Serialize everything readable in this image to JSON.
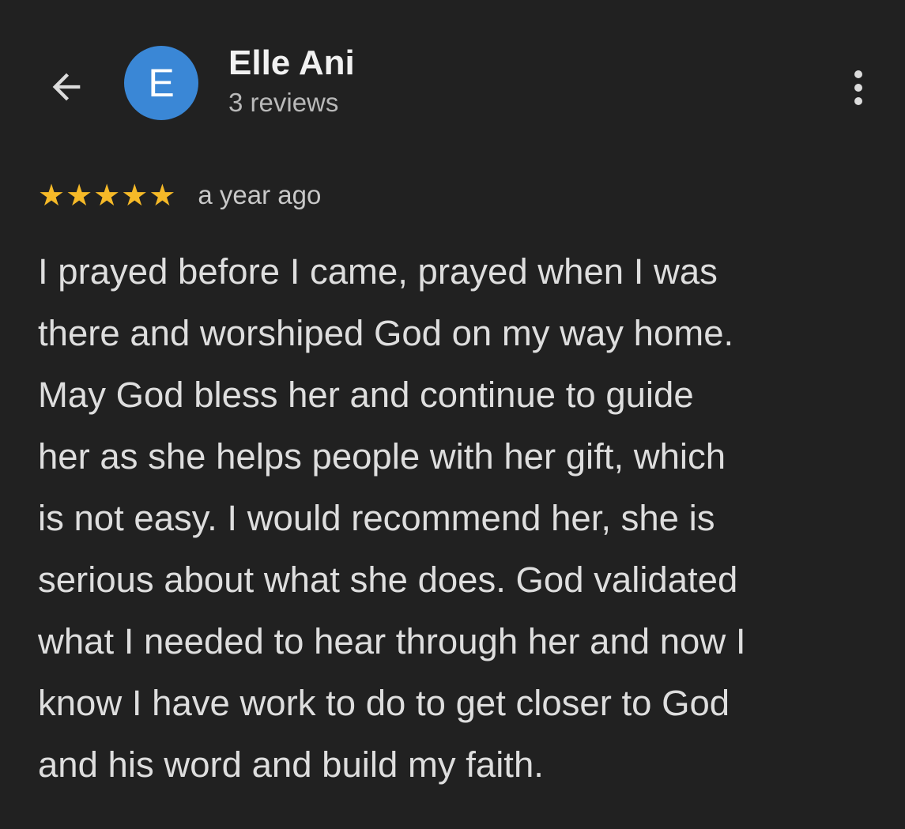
{
  "header": {
    "back_icon": "arrow-left-icon",
    "avatar_letter": "E",
    "avatar_color": "#3a87d6",
    "user_name": "Elle Ani",
    "review_count": "3 reviews",
    "more_icon": "more-vertical-icon"
  },
  "review": {
    "rating": 5,
    "max_rating": 5,
    "star_color": "#f5b928",
    "time_ago": "a year ago",
    "lines": [
      "I prayed before I came, prayed when I was",
      "there and worshiped God on my way home.",
      "May God bless her and continue to guide",
      "her as she helps people with her gift, which",
      "is not easy. I would recommend her, she is",
      "serious about what she does. God validated",
      "what I needed to hear through her and now I",
      "know I have work to do to get closer to God",
      "and his word and build my faith."
    ]
  }
}
